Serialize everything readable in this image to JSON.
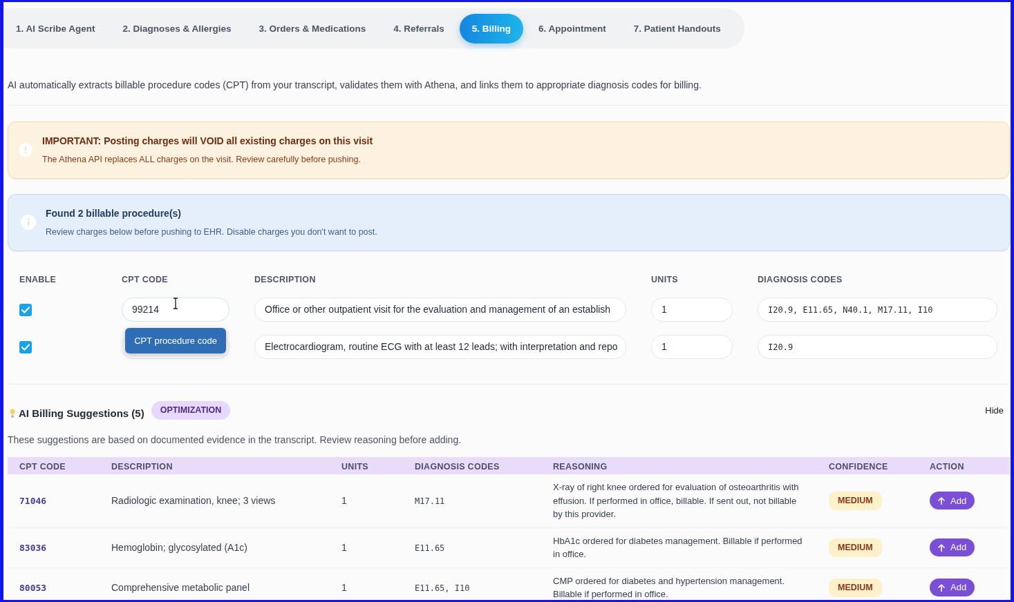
{
  "tabs": [
    {
      "label": "1. AI Scribe Agent",
      "selected": false
    },
    {
      "label": "2. Diagnoses & Allergies",
      "selected": false
    },
    {
      "label": "3. Orders & Medications",
      "selected": false
    },
    {
      "label": "4. Referrals",
      "selected": false
    },
    {
      "label": "5. Billing",
      "selected": true
    },
    {
      "label": "6. Appointment",
      "selected": false
    },
    {
      "label": "7. Patient Handouts",
      "selected": false
    }
  ],
  "intro": "AI automatically extracts billable procedure codes (CPT) from your transcript, validates them with Athena, and links them to appropriate diagnosis codes for billing.",
  "warning": {
    "title": "IMPORTANT: Posting charges will VOID all existing charges on this visit",
    "message": "The Athena API replaces ALL charges on the visit. Review carefully before pushing."
  },
  "info": {
    "title": "Found 2 billable procedure(s)",
    "message": "Review charges below before pushing to EHR. Disable charges you don't want to post."
  },
  "charges": {
    "columns": [
      "ENABLE",
      "CPT CODE",
      "DESCRIPTION",
      "UNITS",
      "DIAGNOSIS CODES"
    ],
    "rows": [
      {
        "enabled": true,
        "cpt_code": "99214",
        "tooltip": "CPT procedure code",
        "description": "Office or other outpatient visit for the evaluation and management of an establish",
        "units": "1",
        "diagnosis_codes": "I20.9, E11.65, N40.1, M17.11, I10"
      },
      {
        "enabled": true,
        "description": "Electrocardiogram, routine ECG with at least 12 leads; with interpretation and repo",
        "units": "1",
        "diagnosis_codes": "I20.9"
      }
    ]
  },
  "suggestions": {
    "title": "AI Billing Suggestions (5)",
    "badge": "OPTIMIZATION",
    "toggle": "Hide",
    "note": "These suggestions are based on documented evidence in the transcript. Review reasoning before adding.",
    "columns": [
      "CPT CODE",
      "DESCRIPTION",
      "UNITS",
      "DIAGNOSIS CODES",
      "REASONING",
      "CONFIDENCE",
      "ACTION"
    ],
    "rows": [
      {
        "cpt_code": "71046",
        "description": "Radiologic examination, knee; 3 views",
        "units": "1",
        "diagnosis_codes": "M17.11",
        "reasoning": "X-ray of right knee ordered for evaluation of osteoarthritis with effusion. If performed in office, billable. If sent out, not billable by this provider.",
        "confidence": "MEDIUM",
        "action": "Add"
      },
      {
        "cpt_code": "83036",
        "description": "Hemoglobin; glycosylated (A1c)",
        "units": "1",
        "diagnosis_codes": "E11.65",
        "reasoning": "HbA1c ordered for diabetes management. Billable if performed in office.",
        "confidence": "MEDIUM",
        "action": "Add"
      },
      {
        "cpt_code": "80053",
        "description": "Comprehensive metabolic panel",
        "units": "1",
        "diagnosis_codes": "E11.65, I10",
        "reasoning": "CMP ordered for diabetes and hypertension management. Billable if performed in office.",
        "confidence": "MEDIUM",
        "action": "Add"
      }
    ]
  }
}
